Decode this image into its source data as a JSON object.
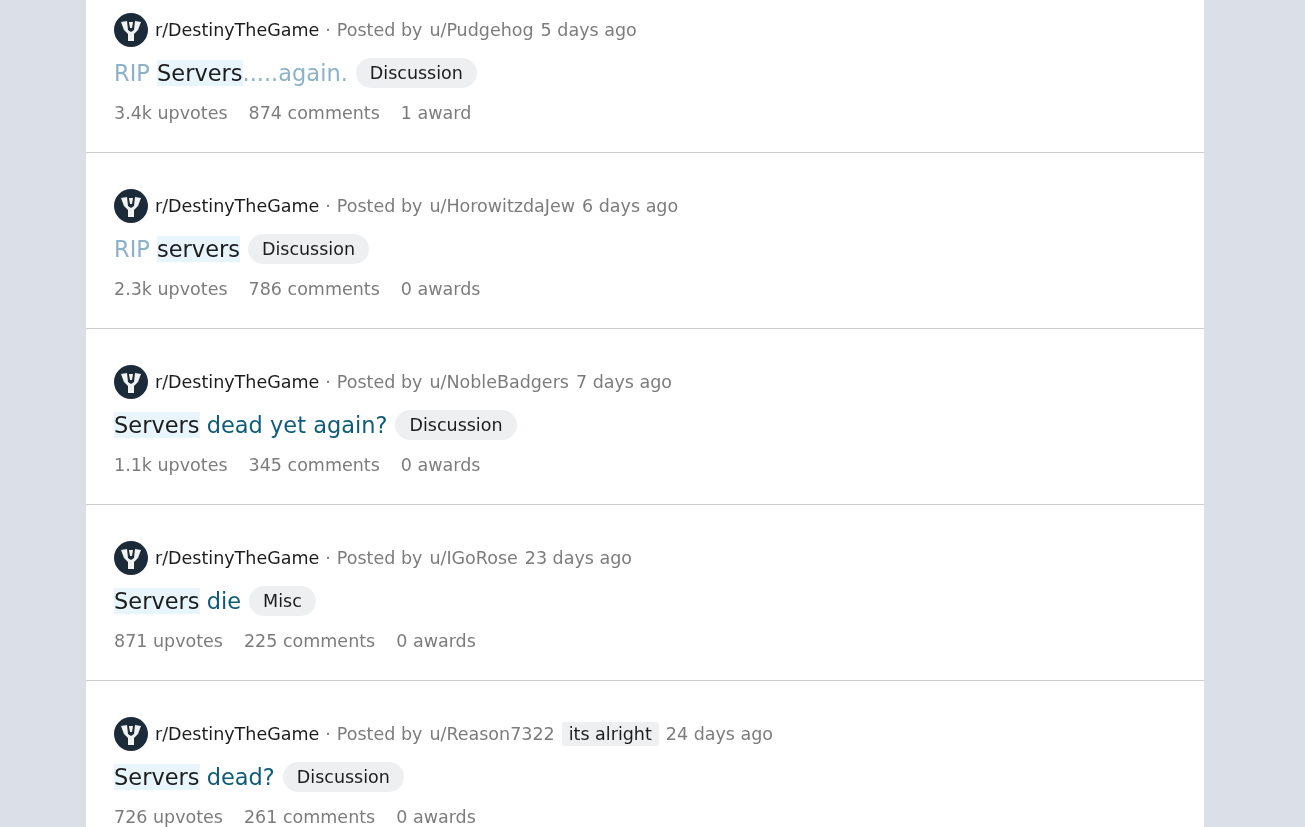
{
  "posts": [
    {
      "subreddit": "r/DestinyTheGame",
      "posted_by": "Posted by",
      "separator": "·",
      "author": "u/Pudgehog",
      "time": "5 days ago",
      "title": [
        {
          "text": "RIP",
          "kind": "visited"
        },
        {
          "text": "Servers",
          "kind": "match"
        },
        {
          "text": ".....again.",
          "kind": "visited",
          "joined": true
        }
      ],
      "flair": "Discussion",
      "upvotes": "3.4k upvotes",
      "comments": "874 comments",
      "awards": "1 award"
    },
    {
      "subreddit": "r/DestinyTheGame",
      "posted_by": "Posted by",
      "separator": "·",
      "author": "u/HorowitzdaJew",
      "time": "6 days ago",
      "title": [
        {
          "text": "RIP",
          "kind": "visited"
        },
        {
          "text": "servers",
          "kind": "match"
        }
      ],
      "flair": "Discussion",
      "upvotes": "2.3k upvotes",
      "comments": "786 comments",
      "awards": "0 awards"
    },
    {
      "subreddit": "r/DestinyTheGame",
      "posted_by": "Posted by",
      "separator": "·",
      "author": "u/NobleBadgers",
      "time": "7 days ago",
      "title": [
        {
          "text": "Servers",
          "kind": "match"
        },
        {
          "text": "dead yet again?",
          "kind": "link"
        }
      ],
      "flair": "Discussion",
      "upvotes": "1.1k upvotes",
      "comments": "345 comments",
      "awards": "0 awards"
    },
    {
      "subreddit": "r/DestinyTheGame",
      "posted_by": "Posted by",
      "separator": "·",
      "author": "u/IGoRose",
      "time": "23 days ago",
      "title": [
        {
          "text": "Servers",
          "kind": "match"
        },
        {
          "text": "die",
          "kind": "link"
        }
      ],
      "flair": "Misc",
      "upvotes": "871 upvotes",
      "comments": "225 comments",
      "awards": "0 awards"
    },
    {
      "subreddit": "r/DestinyTheGame",
      "posted_by": "Posted by",
      "separator": "·",
      "author": "u/Reason7322",
      "user_flair": "its alright",
      "time": "24 days ago",
      "title": [
        {
          "text": "Servers",
          "kind": "match"
        },
        {
          "text": "dead?",
          "kind": "link"
        }
      ],
      "flair": "Discussion",
      "upvotes": "726 upvotes",
      "comments": "261 comments",
      "awards": "0 awards"
    }
  ]
}
